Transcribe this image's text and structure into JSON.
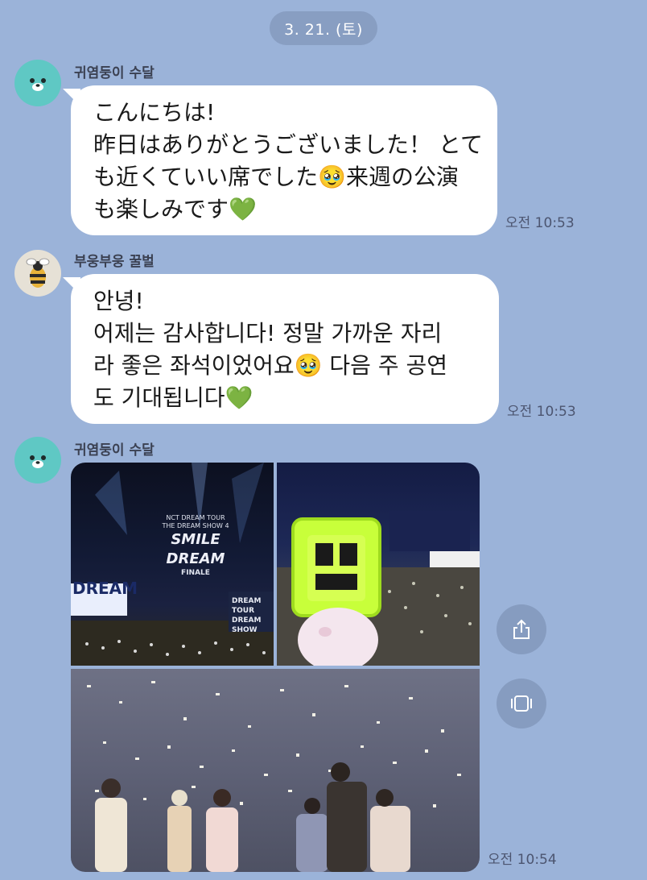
{
  "date_divider": "3. 21. (토)",
  "messages": [
    {
      "sender": "귀염둥이 수달",
      "avatar_icon": "otter-icon",
      "lines": [
        "こんにちは!",
        "昨日はありがとうございました！ とて",
        "も近くていい席でした🥹来週の公演",
        "も楽しみです💚"
      ],
      "time": "오전 10:53"
    },
    {
      "sender": "부웅부웅 꿀벌",
      "avatar_icon": "bee-icon",
      "lines": [
        "안녕!",
        "어제는 감사합니다! 정말 가까운 자리",
        "라 좋은 좌석이었어요🥹  다음 주 공연",
        "도 기대됩니다💚"
      ],
      "time": "오전 10:53"
    },
    {
      "sender": "귀염둥이 수달",
      "avatar_icon": "otter-icon",
      "photos": [
        {
          "name": "concert-stage-photo",
          "screen_text": [
            "NCT DREAM TOUR",
            "THE DREAM SHOW 4",
            "FINALE"
          ],
          "banner_text": "DREAM",
          "side_text": [
            "DREAM TOUR",
            "DREAM SHOW"
          ]
        },
        {
          "name": "lightstick-photo"
        },
        {
          "name": "confetti-stage-photo"
        }
      ],
      "time": "오전 10:54"
    }
  ],
  "actions": {
    "share_icon": "share-icon",
    "fullscreen_icon": "fullscreen-icon"
  },
  "colors": {
    "background": "#9bb3d9",
    "bubble": "#ffffff",
    "otter_avatar": "#5fc8c4",
    "bee_avatar": "#e6e1d6",
    "heart": "#4cc94c"
  }
}
